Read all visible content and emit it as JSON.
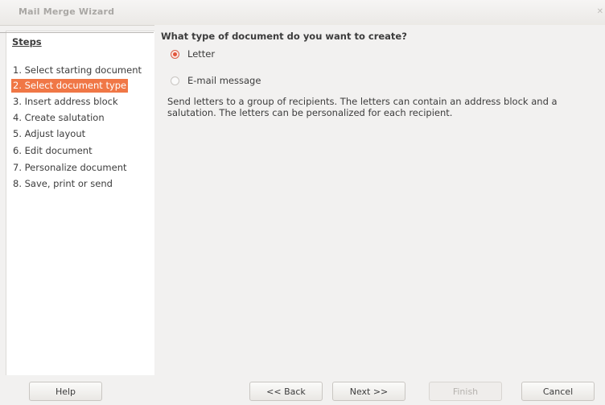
{
  "window": {
    "title": "Mail Merge Wizard"
  },
  "steps": {
    "heading": "Steps",
    "items": [
      "1. Select starting document",
      "2. Select document type",
      "3. Insert address block",
      "4. Create salutation",
      "5. Adjust layout",
      "6. Edit document",
      "7. Personalize document",
      "8. Save, print or send"
    ],
    "active_index": 1
  },
  "main": {
    "question": "What type of document do you want to create?",
    "options": [
      {
        "label": "Letter",
        "checked": true
      },
      {
        "label": "E-mail message",
        "checked": false
      }
    ],
    "description": "Send letters to a group of recipients. The letters can contain an address block and a salutation. The letters can be personalized for each recipient."
  },
  "buttons": {
    "help": "Help",
    "back": "<< Back",
    "next": "Next >>",
    "finish": "Finish",
    "cancel": "Cancel"
  },
  "colors": {
    "accent": "#f07746",
    "radio": "#e2553b"
  }
}
